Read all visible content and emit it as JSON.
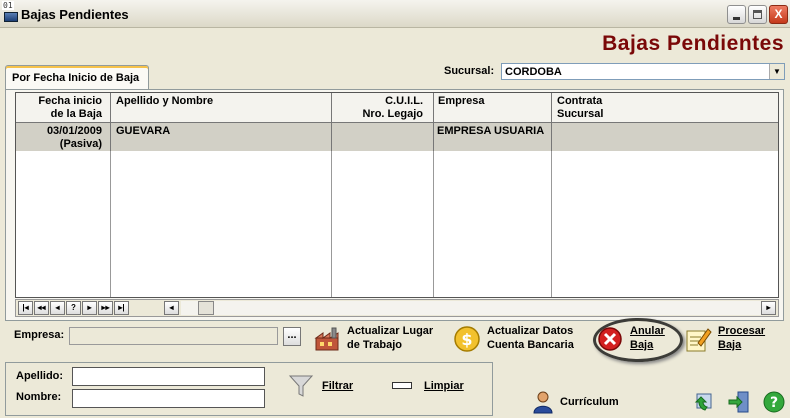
{
  "window": {
    "title": "Bajas Pendientes",
    "icon_number": "01",
    "min_glyph": "_",
    "max_glyph": "□",
    "close_glyph": "X"
  },
  "header": {
    "big_title": "Bajas Pendientes"
  },
  "tabs": [
    {
      "label": "Por Fecha Inicio de Baja"
    }
  ],
  "sucursal": {
    "label": "Sucursal:",
    "value": "CORDOBA"
  },
  "grid": {
    "columns": [
      {
        "line1": "Fecha inicio",
        "line2": "de la Baja"
      },
      {
        "line1": "Apellido y Nombre",
        "line2": ""
      },
      {
        "line1": "C.U.I.L.",
        "line2": "Nro. Legajo"
      },
      {
        "line1": "Empresa",
        "line2": ""
      },
      {
        "line1": "Contrata",
        "line2": "Sucursal"
      }
    ],
    "rows": [
      {
        "fecha": "03/01/2009",
        "estado": "(Pasiva)",
        "nombre": "GUEVARA",
        "cuil": "",
        "empresa": "EMPRESA USUARIA",
        "contrata": ""
      }
    ]
  },
  "navigator": {
    "first": "|◂",
    "prev_page": "◂◂",
    "prev": "◂",
    "info": "?",
    "next": "▸",
    "next_page": "▸▸",
    "last": "▸|",
    "scroll_left": "◂",
    "scroll_right": "▸"
  },
  "empresa": {
    "label": "Empresa:",
    "value": "",
    "browse": "..."
  },
  "actions": {
    "actualizar_lugar": {
      "line1": "Actualizar Lugar",
      "line2": "de Trabajo",
      "icon": "factory-icon"
    },
    "actualizar_datos": {
      "line1": "Actualizar Datos",
      "line2": "Cuenta Bancaria",
      "icon": "dollar-coin-icon"
    },
    "anular": {
      "line1": "Anular",
      "line2": "Baja",
      "icon": "cancel-x-icon"
    },
    "procesar": {
      "line1": "Procesar",
      "line2": "Baja",
      "icon": "pencil-note-icon"
    }
  },
  "filter": {
    "apellido_label": "Apellido:",
    "apellido_value": "",
    "nombre_label": "Nombre:",
    "nombre_value": "",
    "filtrar": "Filtrar",
    "limpiar": "Limpiar"
  },
  "curriculum": {
    "label": "Currículum"
  },
  "colors": {
    "title_red": "#7a0808",
    "window_bg": "#ece9d8",
    "selected_row": "#d2d0c6"
  }
}
